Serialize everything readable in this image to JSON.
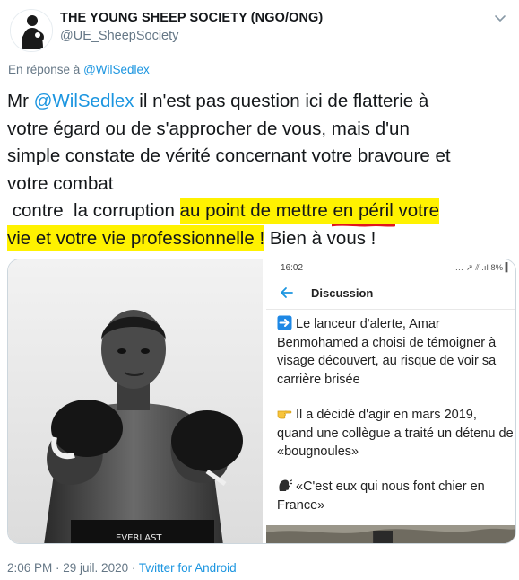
{
  "header": {
    "display_name": "THE YOUNG SHEEP SOCIETY (NGO/ONG)",
    "handle": "@UE_SheepSociety"
  },
  "reply": {
    "prefix": "En réponse à ",
    "mention": "@WilSedlex"
  },
  "tweet": {
    "l1_a": "Mr ",
    "l1_mention": "@WilSedlex",
    "l1_b": " il n'est pas question ici de flatterie à",
    "l2": "votre égard ou de s'approcher de vous, mais d'un",
    "l3": "simple constate de vérité concernant votre bravoure et",
    "l4": "votre combat",
    "l5_a": " contre  la corruption ",
    "l5_hl1": "au point de mettre ",
    "l5_hl_peril": "en péril",
    "l5_hl2": " votre",
    "l6_hl": "vie et votre vie professionnelle !",
    "l6_b": " Bien à vous !"
  },
  "phone": {
    "time": "16:02",
    "status_right": "… ↗ ⫽ .ıl 8% ▍",
    "title": "Discussion",
    "messages": [
      "Le lanceur d'alerte, Amar Benmohamed a choisi de témoigner à visage découvert, au risque de voir sa carrière brisée",
      "Il a décidé d'agir en mars 2019, quand une collègue a traité un détenu de «bougnoules»",
      "«C'est eux qui nous font chier en France»"
    ],
    "emojis": [
      "right-arrow-emoji",
      "pointing-hand-emoji",
      "speaking-head-emoji"
    ]
  },
  "photo": {
    "trunks_text": "EVERLAST"
  },
  "footer": {
    "time": "2:06 PM",
    "sep1": " · ",
    "date": "29 juil. 2020",
    "sep2": " · ",
    "source": "Twitter for Android"
  },
  "colors": {
    "link": "#1b95e0",
    "highlight": "#fff200",
    "underline": "#e0161e",
    "muted": "#657786"
  }
}
